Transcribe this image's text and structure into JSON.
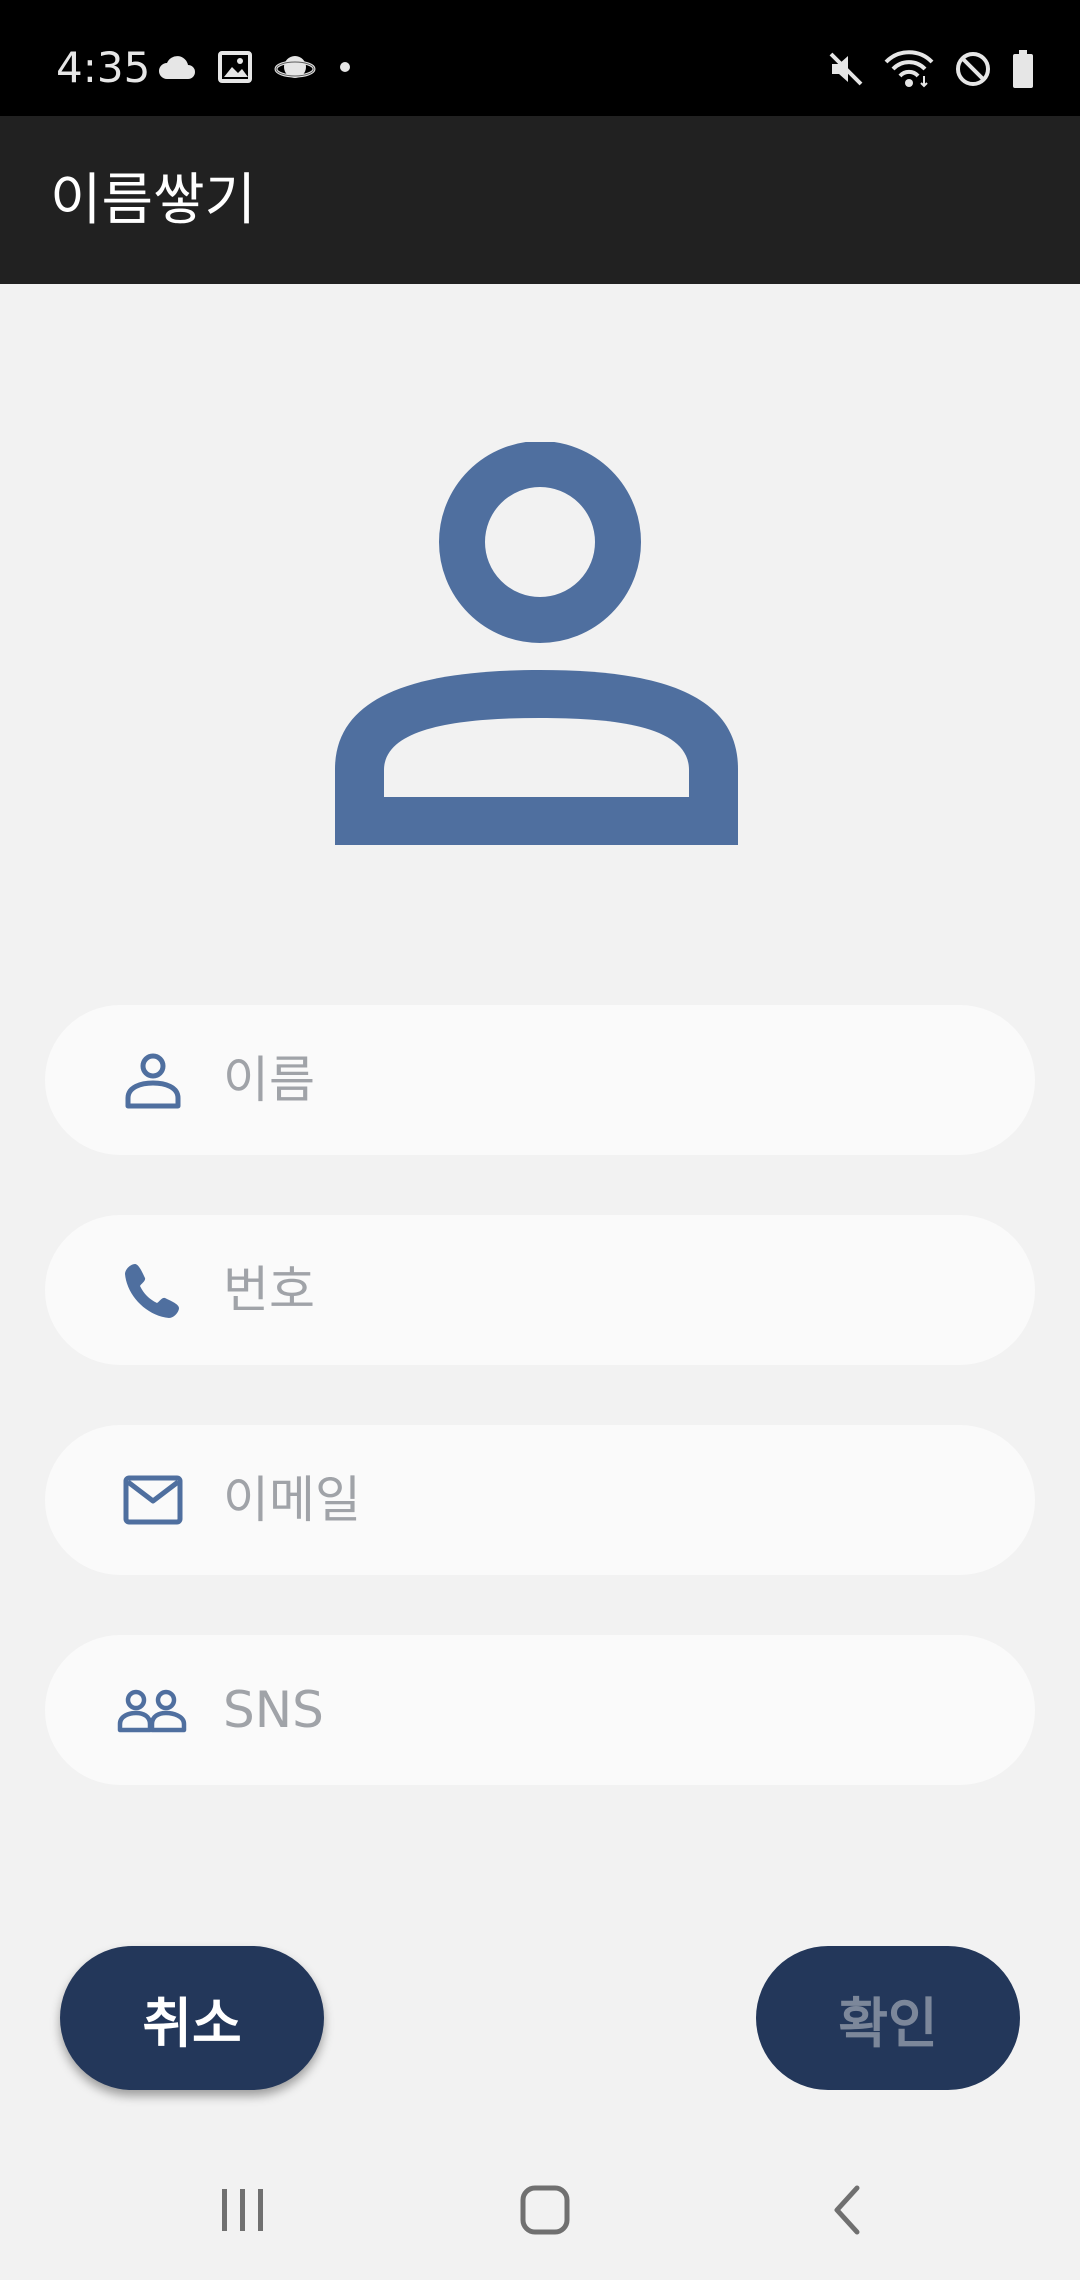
{
  "status_bar": {
    "time": "4:35",
    "left_icons": [
      "cloud-icon",
      "image-icon",
      "planet-icon",
      "dot-icon"
    ],
    "right_icons": [
      "mute-icon",
      "wifi-icon",
      "do-not-disturb-icon",
      "battery-icon"
    ]
  },
  "app_bar": {
    "title": "이름쌓기"
  },
  "avatar": {
    "icon": "person-icon",
    "color": "#4f6f9f"
  },
  "form": {
    "name": {
      "placeholder": "이름",
      "value": "",
      "icon": "person-icon"
    },
    "phone": {
      "placeholder": "번호",
      "value": "",
      "icon": "phone-icon"
    },
    "email": {
      "placeholder": "이메일",
      "value": "",
      "icon": "mail-icon"
    },
    "sns": {
      "placeholder": "SNS",
      "value": "",
      "icon": "people-icon"
    }
  },
  "buttons": {
    "cancel_label": "취소",
    "confirm_label": "확인"
  },
  "nav_bar": {
    "icons": [
      "recent-apps-icon",
      "home-icon",
      "back-icon"
    ]
  },
  "colors": {
    "accent": "#4f6f9f",
    "button_bg": "#23375a",
    "app_bar_bg": "#212121",
    "background": "#f2f2f2"
  }
}
